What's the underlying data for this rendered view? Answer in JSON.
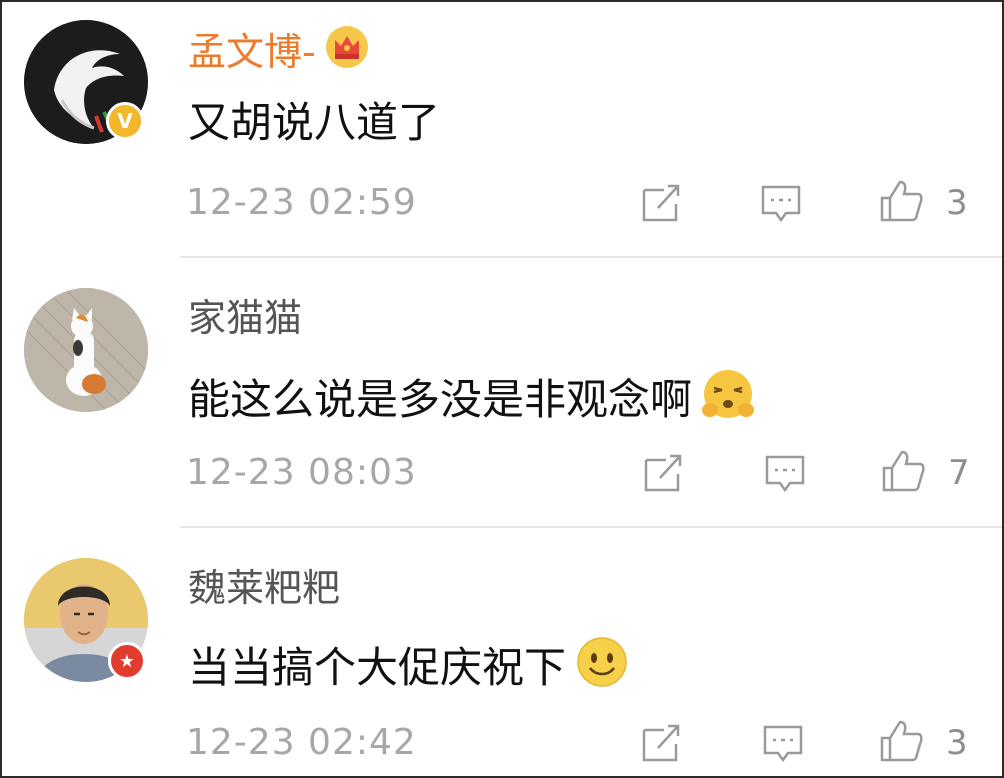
{
  "comments": [
    {
      "username": "孟文博-",
      "text": "又胡说八道了",
      "time": "12-23 02:59",
      "likes": "3",
      "badge": "V",
      "username_color": "#ee7b2c"
    },
    {
      "username": "家猫猫",
      "text": "能这么说是多没是非观念啊",
      "time": "12-23 08:03",
      "likes": "7",
      "username_color": "#555555"
    },
    {
      "username": "魏莱粑粑",
      "text": "当当搞个大促庆祝下",
      "time": "12-23 02:42",
      "likes": "3",
      "badge": "★",
      "username_color": "#555555"
    }
  ],
  "icons": [
    "eagle-avatar",
    "crown-icon",
    "repost-icon",
    "comment-icon",
    "like-icon",
    "angry-emoji-icon",
    "smile-emoji-icon"
  ]
}
